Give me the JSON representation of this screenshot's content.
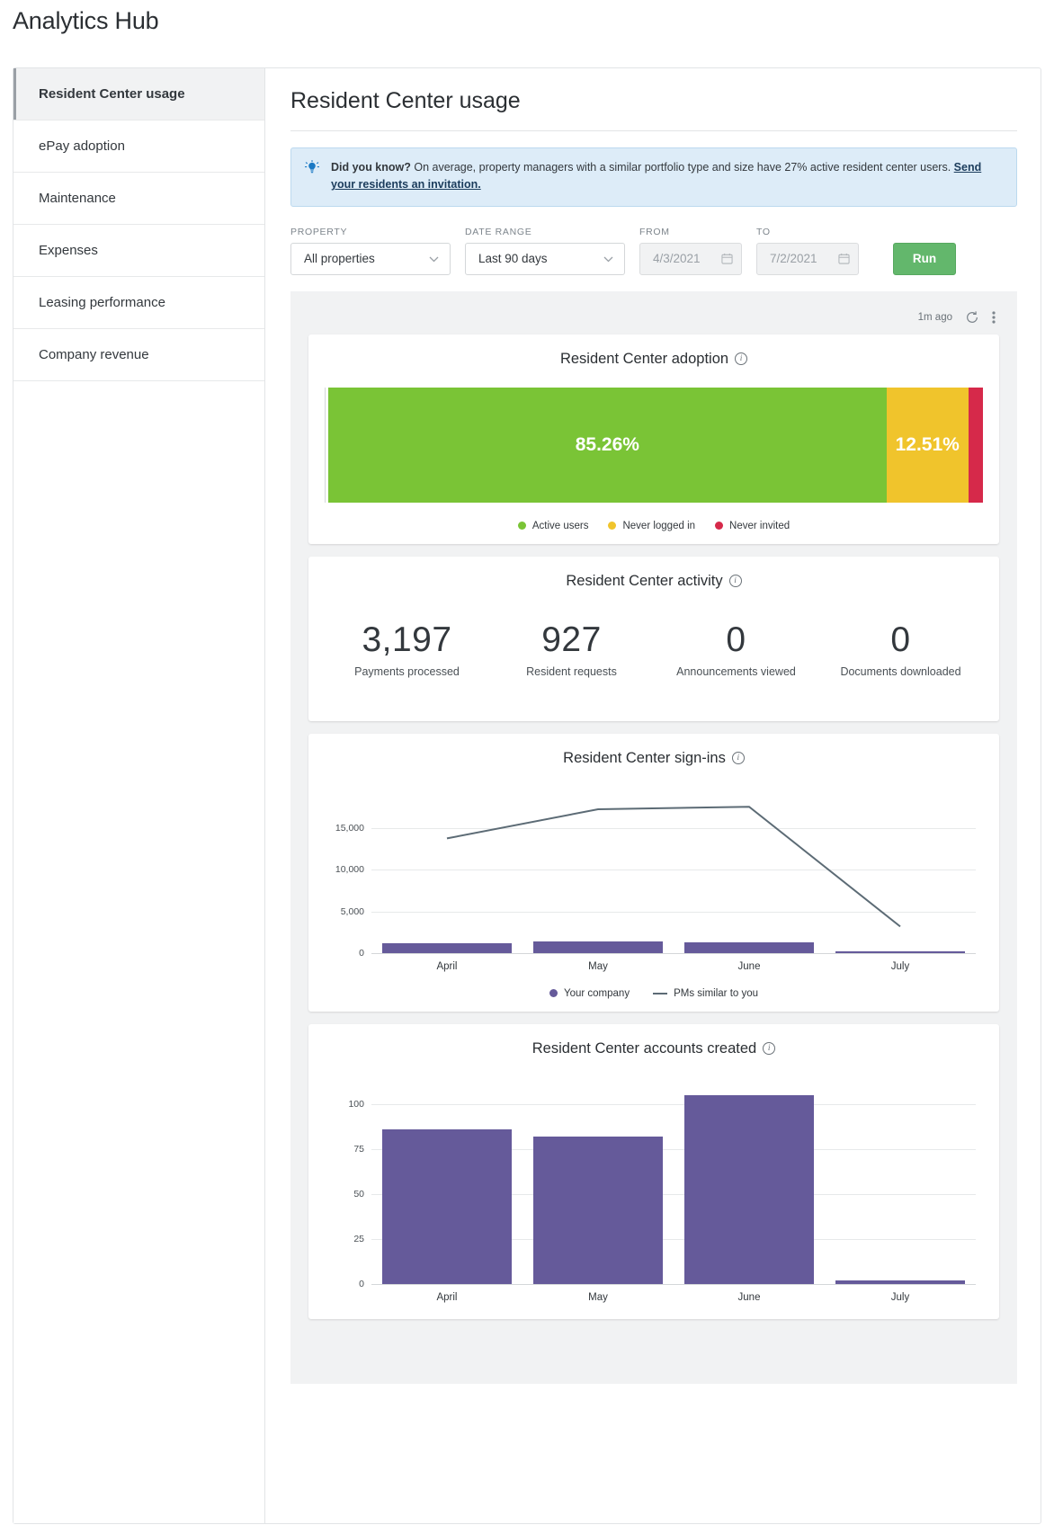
{
  "app": {
    "title": "Analytics Hub"
  },
  "sidebar": {
    "items": [
      {
        "label": "Resident Center usage",
        "active": true
      },
      {
        "label": "ePay adoption",
        "active": false
      },
      {
        "label": "Maintenance",
        "active": false
      },
      {
        "label": "Expenses",
        "active": false
      },
      {
        "label": "Leasing performance",
        "active": false
      },
      {
        "label": "Company revenue",
        "active": false
      }
    ]
  },
  "main": {
    "page_title": "Resident Center usage",
    "banner": {
      "lead": "Did you know?",
      "body": " On average, property managers with a similar portfolio type and size have 27% active resident center users. ",
      "link": "Send your residents an invitation."
    },
    "filters": {
      "property_label": "PROPERTY",
      "property_value": "All properties",
      "date_range_label": "DATE RANGE",
      "date_range_value": "Last 90 days",
      "from_label": "FROM",
      "from_value": "4/3/2021",
      "to_label": "TO",
      "to_value": "7/2/2021",
      "run_label": "Run"
    },
    "toolbar": {
      "last_updated": "1m ago",
      "refresh_icon": "refresh-icon",
      "more_icon": "kebab-menu-icon"
    }
  },
  "colors": {
    "green": "#7ac436",
    "yellow": "#f0c42c",
    "red": "#d6294a",
    "purple": "#655a9a",
    "line": "#5c6b75",
    "run_green": "#63b76c"
  },
  "chart_data": [
    {
      "type": "bar",
      "id": "resident-center-adoption",
      "title": "Resident Center adoption",
      "orientation": "horizontal-stacked",
      "categories": [
        "Active users",
        "Never logged in",
        "Never invited"
      ],
      "values": [
        85.26,
        12.51,
        2.23
      ],
      "labels": [
        "85.26%",
        "12.51%",
        ""
      ],
      "colors": [
        "#7ac436",
        "#f0c42c",
        "#d6294a"
      ],
      "legend": [
        "Active users",
        "Never logged in",
        "Never invited"
      ],
      "legend_position": "bottom",
      "xlabel": "",
      "ylabel": "",
      "grid": false
    },
    {
      "type": "table",
      "id": "resident-center-activity",
      "title": "Resident Center activity",
      "categories": [
        "Payments processed",
        "Resident requests",
        "Announcements viewed",
        "Documents downloaded"
      ],
      "values": [
        "3,197",
        "927",
        "0",
        "0"
      ]
    },
    {
      "type": "bar",
      "id": "resident-center-sign-ins",
      "title": "Resident Center sign-ins",
      "categories": [
        "April",
        "May",
        "June",
        "July"
      ],
      "series": [
        {
          "name": "Your company",
          "type": "bar",
          "values": [
            1150,
            1400,
            1250,
            60
          ],
          "color": "#655a9a"
        },
        {
          "name": "PMs similar to you",
          "type": "line",
          "values": [
            13800,
            17300,
            17600,
            3200
          ],
          "color": "#5c6b75"
        }
      ],
      "yticks": [
        0,
        5000,
        10000,
        15000
      ],
      "ytick_labels": [
        "0",
        "5,000",
        "10,000",
        "15,000"
      ],
      "ylim": [
        0,
        20000
      ],
      "legend": [
        "Your company",
        "PMs similar to you"
      ],
      "legend_position": "bottom",
      "xlabel": "",
      "ylabel": "",
      "grid": true
    },
    {
      "type": "bar",
      "id": "resident-center-accounts-created",
      "title": "Resident Center accounts created",
      "categories": [
        "April",
        "May",
        "June",
        "July"
      ],
      "values": [
        86,
        82,
        105,
        2
      ],
      "color": "#655a9a",
      "yticks": [
        0,
        25,
        50,
        75,
        100
      ],
      "ytick_labels": [
        "0",
        "25",
        "50",
        "75",
        "100"
      ],
      "ylim": [
        0,
        115
      ],
      "xlabel": "",
      "ylabel": "",
      "grid": true
    }
  ]
}
